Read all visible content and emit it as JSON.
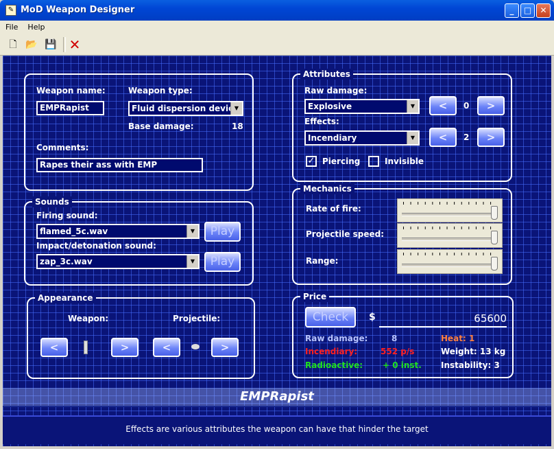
{
  "window": {
    "title": "MoD Weapon Designer",
    "min": "_",
    "max": "□",
    "close": "✕"
  },
  "menu": {
    "file": "File",
    "help": "Help"
  },
  "toolbar": {
    "new": "🗋",
    "open": "📂",
    "save": "💾",
    "delete": "✕"
  },
  "weapon": {
    "name_label": "Weapon name:",
    "name_value": "EMPRapist",
    "type_label": "Weapon type:",
    "type_value": "Fluid dispersion device",
    "base_damage_label": "Base damage:",
    "base_damage_value": "18",
    "comments_label": "Comments:",
    "comments_value": "Rapes their ass with EMP"
  },
  "sounds": {
    "legend": "Sounds",
    "firing_label": "Firing sound:",
    "firing_value": "flamed_5c.wav",
    "impact_label": "Impact/detonation sound:",
    "impact_value": "zap_3c.wav",
    "play": "Play"
  },
  "appearance": {
    "legend": "Appearance",
    "weapon_label": "Weapon:",
    "projectile_label": "Projectile:",
    "prev": "<",
    "next": ">"
  },
  "attributes": {
    "legend": "Attributes",
    "raw_damage_label": "Raw damage:",
    "raw_damage_value": "Explosive",
    "raw_damage_count": "0",
    "effects_label": "Effects:",
    "effects_value": "Incendiary",
    "effects_count": "2",
    "piercing_label": "Piercing",
    "piercing_checked": true,
    "invisible_label": "Invisible",
    "invisible_checked": false,
    "prev": "<",
    "next": ">"
  },
  "mechanics": {
    "legend": "Mechanics",
    "rate_of_fire_label": "Rate of fire:",
    "projectile_speed_label": "Projectile speed:",
    "range_label": "Range:",
    "rate_of_fire_level": 1.0,
    "projectile_speed_level": 1.0,
    "range_level": 1.0
  },
  "price": {
    "legend": "Price",
    "check": "Check",
    "currency": "$",
    "value": "65600",
    "raw_damage_label": "Raw damage:",
    "raw_damage_value": "8",
    "incendiary_label": "Incendiary:",
    "incendiary_value": "552 p/s",
    "radioactive_label": "Radioactive:",
    "radioactive_value": "+ 0 inst.",
    "heat_label": "Heat: 1",
    "weight_label": "Weight: 13 kg",
    "instability_label": "Instability: 3",
    "colors": {
      "incendiary": "#ff2020",
      "radioactive": "#20e020",
      "heat": "#ff8040"
    }
  },
  "banner": {
    "name": "EMPRapist"
  },
  "status": {
    "text": "Effects are various attributes the weapon can have that hinder the target"
  }
}
